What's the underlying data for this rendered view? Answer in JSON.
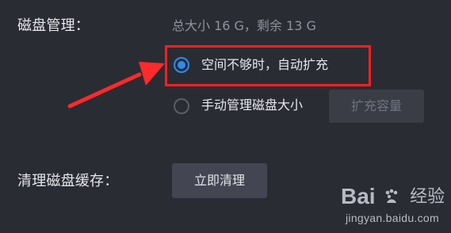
{
  "disk": {
    "label": "磁盘管理：",
    "summary": "总大小 16 G，剩余 13 G",
    "options": [
      {
        "label": "空间不够时，自动扩充",
        "selected": true
      },
      {
        "label": "手动管理磁盘大小",
        "selected": false
      }
    ],
    "expand_button": "扩充容量"
  },
  "cache": {
    "label": "清理磁盘缓存：",
    "clear_button": "立即清理"
  },
  "annotation": {
    "arrow_color": "#ff2a2a",
    "box_color": "#ff1f1f"
  },
  "watermark": {
    "text_1": "Bai",
    "text_2": "经验",
    "url": "jingyan.baidu.com"
  }
}
